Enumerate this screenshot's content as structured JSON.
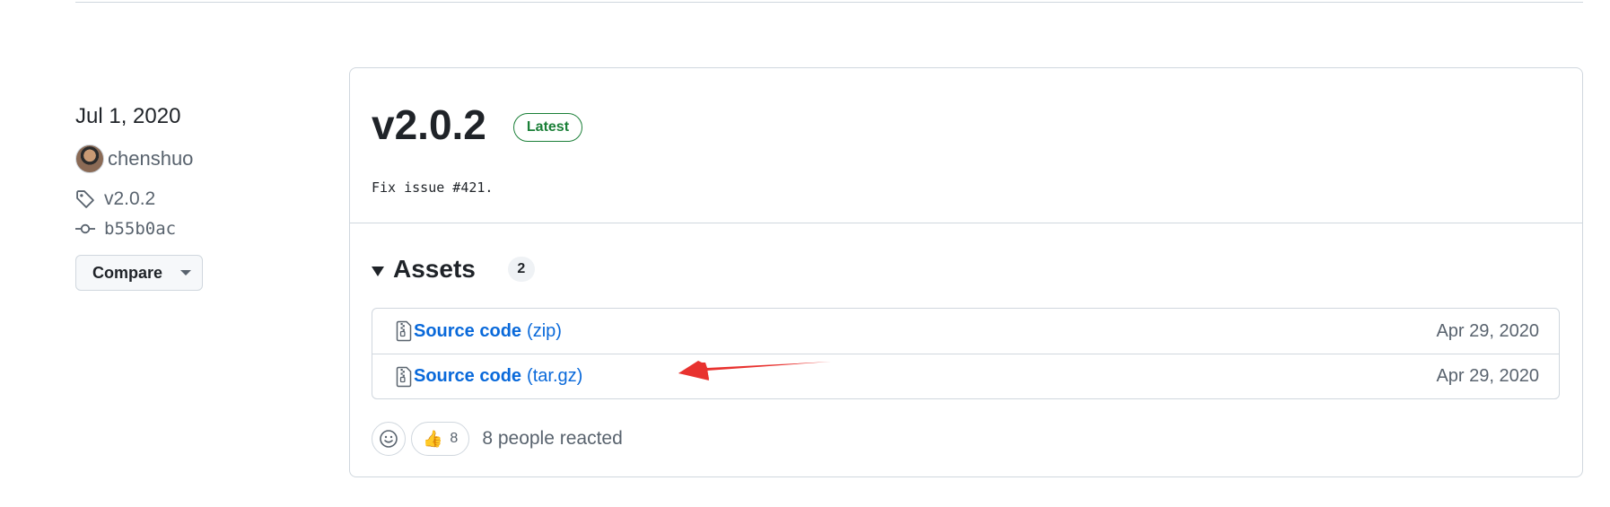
{
  "meta": {
    "date": "Jul 1, 2020",
    "author": "chenshuo",
    "tag": "v2.0.2",
    "commit": "b55b0ac",
    "compare_label": "Compare"
  },
  "release": {
    "title": "v2.0.2",
    "badge": "Latest",
    "notes": "Fix issue #421."
  },
  "assets": {
    "title": "Assets",
    "count": "2",
    "items": [
      {
        "name": "Source code",
        "ext": "(zip)",
        "date": "Apr 29, 2020"
      },
      {
        "name": "Source code",
        "ext": "(tar.gz)",
        "date": "Apr 29, 2020"
      }
    ]
  },
  "reactions": {
    "thumbs_count": "8",
    "summary": "8 people reacted"
  },
  "icons": {
    "tag": "tag-icon",
    "commit": "git-commit-icon",
    "archive": "file-zip-icon",
    "smiley": "smiley-icon",
    "thumbs": "thumbs-up-icon"
  },
  "colors": {
    "link": "#0969da",
    "latest_badge": "#1a7f37",
    "annotation_arrow": "#e8322f"
  }
}
